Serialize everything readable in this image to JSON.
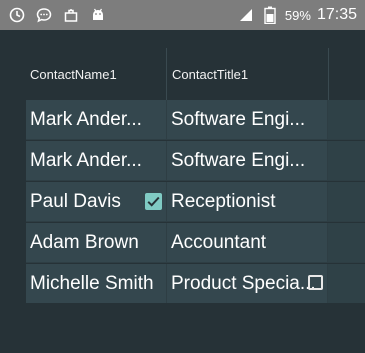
{
  "status_bar": {
    "left_icons": [
      "clock-icon",
      "chat-icon",
      "bag-icon",
      "android-icon"
    ],
    "battery": "59%",
    "time": "17:35"
  },
  "grid": {
    "columns": [
      "ContactName1",
      "ContactTitle1"
    ],
    "rows": [
      {
        "name": "Mark Ander...",
        "title": "Software Engi..."
      },
      {
        "name": "Mark Ander...",
        "title": "Software Engi..."
      },
      {
        "name": "Paul Davis",
        "title": "Receptionist",
        "checked": true
      },
      {
        "name": "Adam Brown",
        "title": "Accountant"
      },
      {
        "name": "Michelle Smith",
        "title": "Product Specia...",
        "checkbox_unchecked": true
      }
    ]
  },
  "colors": {
    "background": "#263237",
    "cell": "#34474e",
    "accent": "#80cbc4",
    "status_bar": "#7d7d7d"
  }
}
